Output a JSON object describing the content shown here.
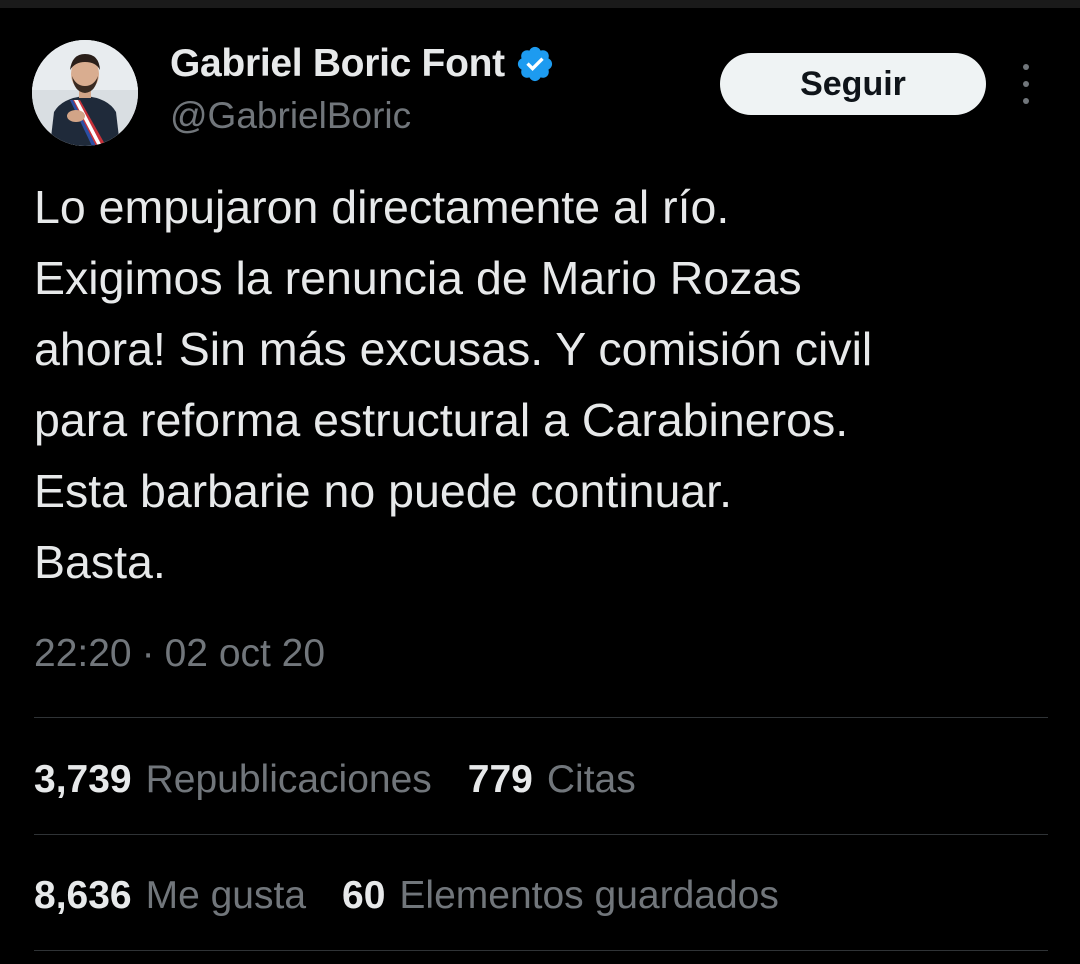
{
  "author": {
    "display_name": "Gabriel Boric Font",
    "handle": "@GabrielBoric",
    "verified": true,
    "verified_color": "#1d9bf0"
  },
  "follow_button": {
    "label": "Seguir"
  },
  "tweet": {
    "lines": [
      "Lo empujaron directamente al río.",
      "Exigimos la renuncia de Mario Rozas",
      "ahora! Sin más excusas. Y comisión civil",
      "para reforma estructural a Carabineros.",
      "Esta barbarie no puede continuar.",
      "Basta."
    ],
    "time": "22:20",
    "separator": "·",
    "date": "02 oct 20"
  },
  "stats": {
    "row1": [
      {
        "count": "3,739",
        "label": "Republicaciones"
      },
      {
        "count": "779",
        "label": "Citas"
      }
    ],
    "row2": [
      {
        "count": "8,636",
        "label": "Me gusta"
      },
      {
        "count": "60",
        "label": "Elementos guardados"
      }
    ]
  },
  "icons": {
    "avatar": "profile-photo",
    "badge": "verified-badge-icon",
    "more": "more-options-icon"
  },
  "colors": {
    "background": "#000000",
    "primary_text": "#e7e9ea",
    "secondary_text": "#71767b",
    "divider": "#2f3336",
    "button_bg": "#eff3f4"
  }
}
